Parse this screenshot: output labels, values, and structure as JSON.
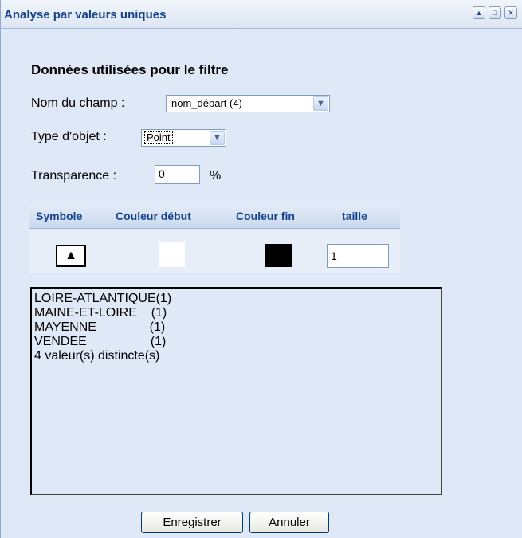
{
  "window": {
    "title": "Analyse par valeurs uniques"
  },
  "section": {
    "heading": "Données utilisées pour le filtre"
  },
  "fields": {
    "nom_champ_label": "Nom du champ :",
    "nom_champ_value": "nom_départ (4)",
    "type_objet_label": "Type d'objet :",
    "type_objet_value": "Point",
    "transparence_label": "Transparence :",
    "transparence_value": "0",
    "transparence_unit": "%"
  },
  "grid": {
    "headers": [
      "Symbole",
      "Couleur début",
      "Couleur fin",
      "taille"
    ],
    "row": {
      "symbol": "▲",
      "start_color": "#ffffff",
      "end_color": "#000000",
      "taille": "1"
    }
  },
  "list": {
    "items": [
      "LOIRE-ATLANTIQUE(1)",
      "MAINE-ET-LOIRE    (1)",
      "MAYENNE               (1)",
      "VENDEE                  (1)",
      "4 valeur(s) distincte(s)"
    ]
  },
  "buttons": {
    "save": "Enregistrer",
    "cancel": "Annuler"
  }
}
